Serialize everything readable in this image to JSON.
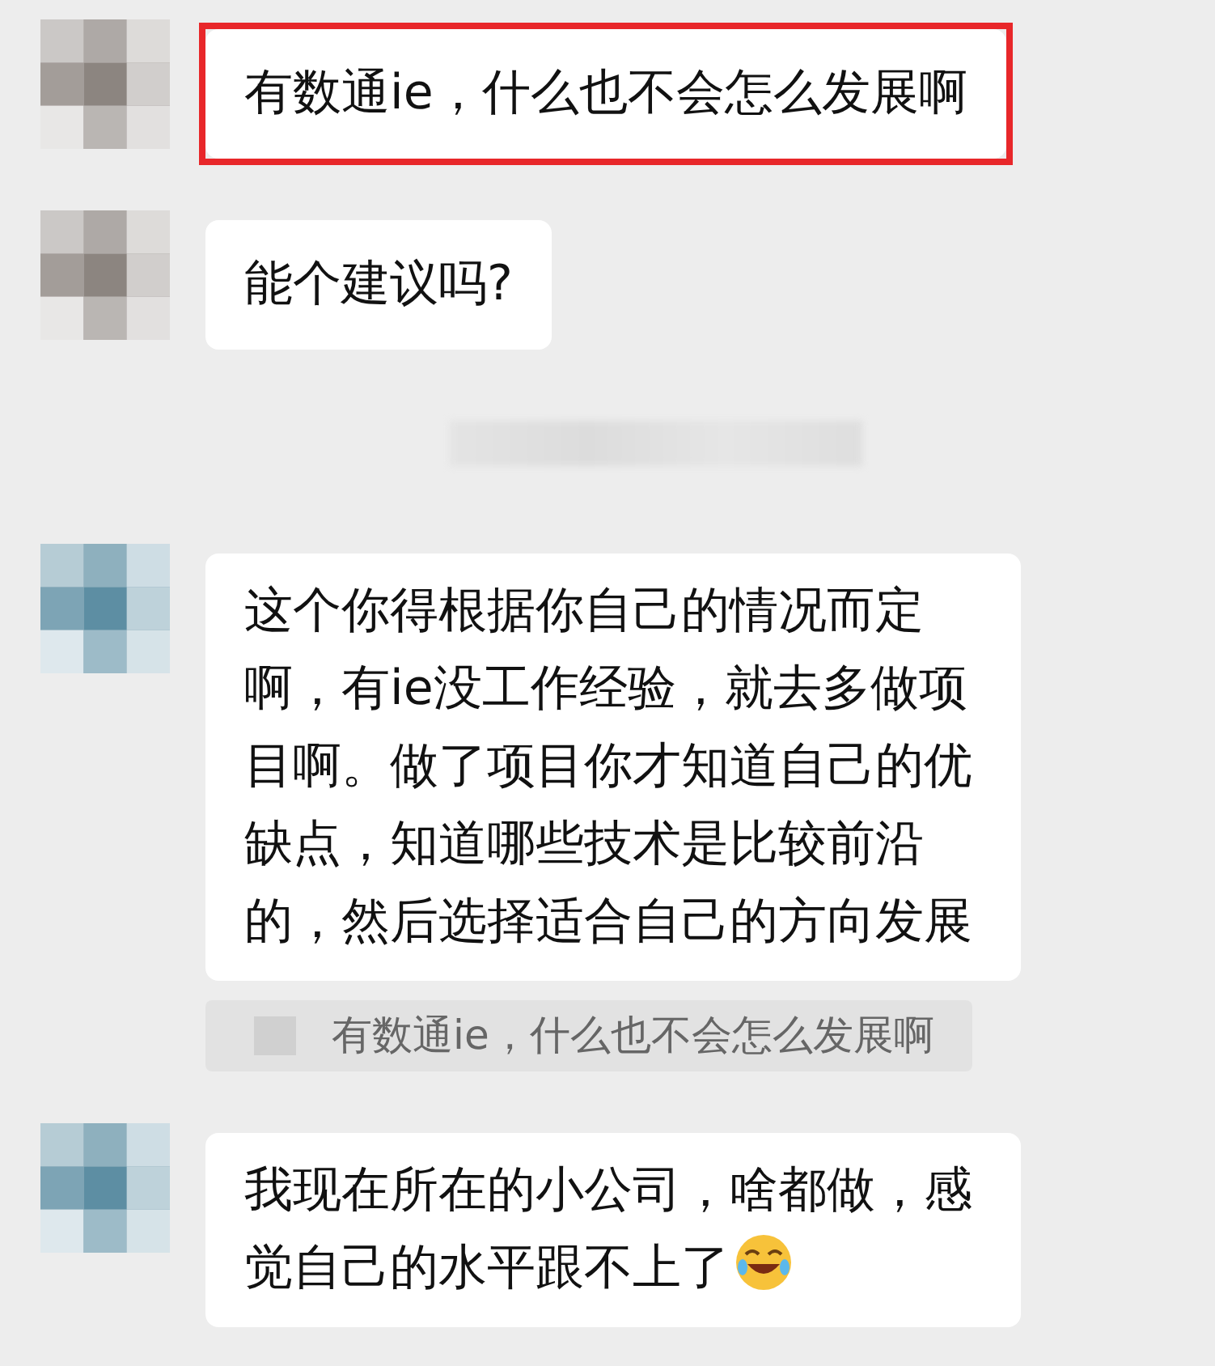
{
  "messages": [
    {
      "kind": "text",
      "text": "有数通ie，什么也不会怎么发展啊",
      "highlighted": true,
      "color": "#8c8580"
    },
    {
      "kind": "text",
      "text": "能个建议吗?",
      "highlighted": false,
      "color": "#8c8580"
    },
    {
      "kind": "time"
    },
    {
      "kind": "text",
      "text": "这个你得根据你自己的情况而定啊，有ie没工作经验，就去多做项目啊。做了项目你才知道自己的优缺点，知道哪些技术是比较前沿的，然后选择适合自己的方向发展",
      "highlighted": false,
      "color": "#5d8ea3",
      "quote": "有数通ie，什么也不会怎么发展啊"
    },
    {
      "kind": "text",
      "text": "我现在所在的小公司，啥都做，感觉自己的水平跟不上了",
      "highlighted": false,
      "color": "#5d8ea3",
      "emoji": true
    }
  ]
}
